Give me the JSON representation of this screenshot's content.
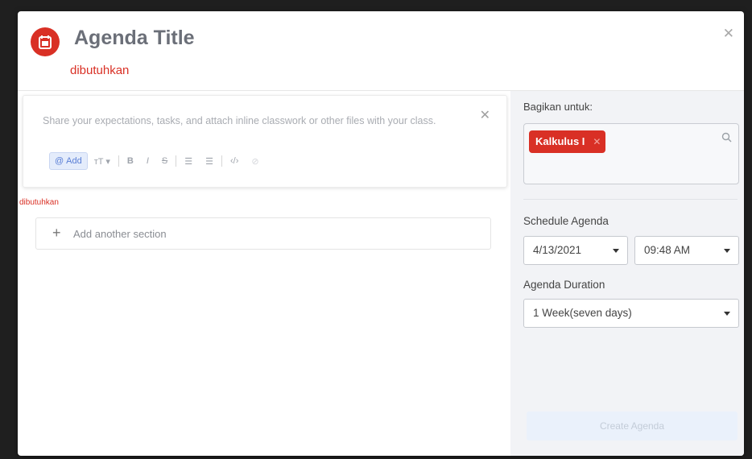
{
  "header": {
    "title": "Agenda Title",
    "title_required": "dibutuhkan",
    "close_icon": "close-icon"
  },
  "editor": {
    "placeholder": "Share your expectations, tasks, and attach inline classwork or other files with your class.",
    "toolbar": {
      "add_label": "Add",
      "text_size": "тT",
      "bold": "B",
      "italic": "I",
      "strike": "S",
      "bulleted_list": "☰",
      "numbered_list": "☰",
      "code": "‹/›",
      "link": "⊘"
    }
  },
  "content": {
    "required_label": "dibutuhkan",
    "add_section_label": "Add another section"
  },
  "sidebar": {
    "share_label": "Bagikan untuk:",
    "share_chip": "Kalkulus I",
    "schedule_label": "Schedule Agenda",
    "date_value": "4/13/2021",
    "time_value": "09:48 AM",
    "duration_label": "Agenda Duration",
    "duration_value": "1 Week(seven days)",
    "create_button": "Create Agenda"
  },
  "colors": {
    "accent_red": "#d93025",
    "panel_bg": "#f2f3f6",
    "primary_disabled": "#eaf1fb"
  }
}
